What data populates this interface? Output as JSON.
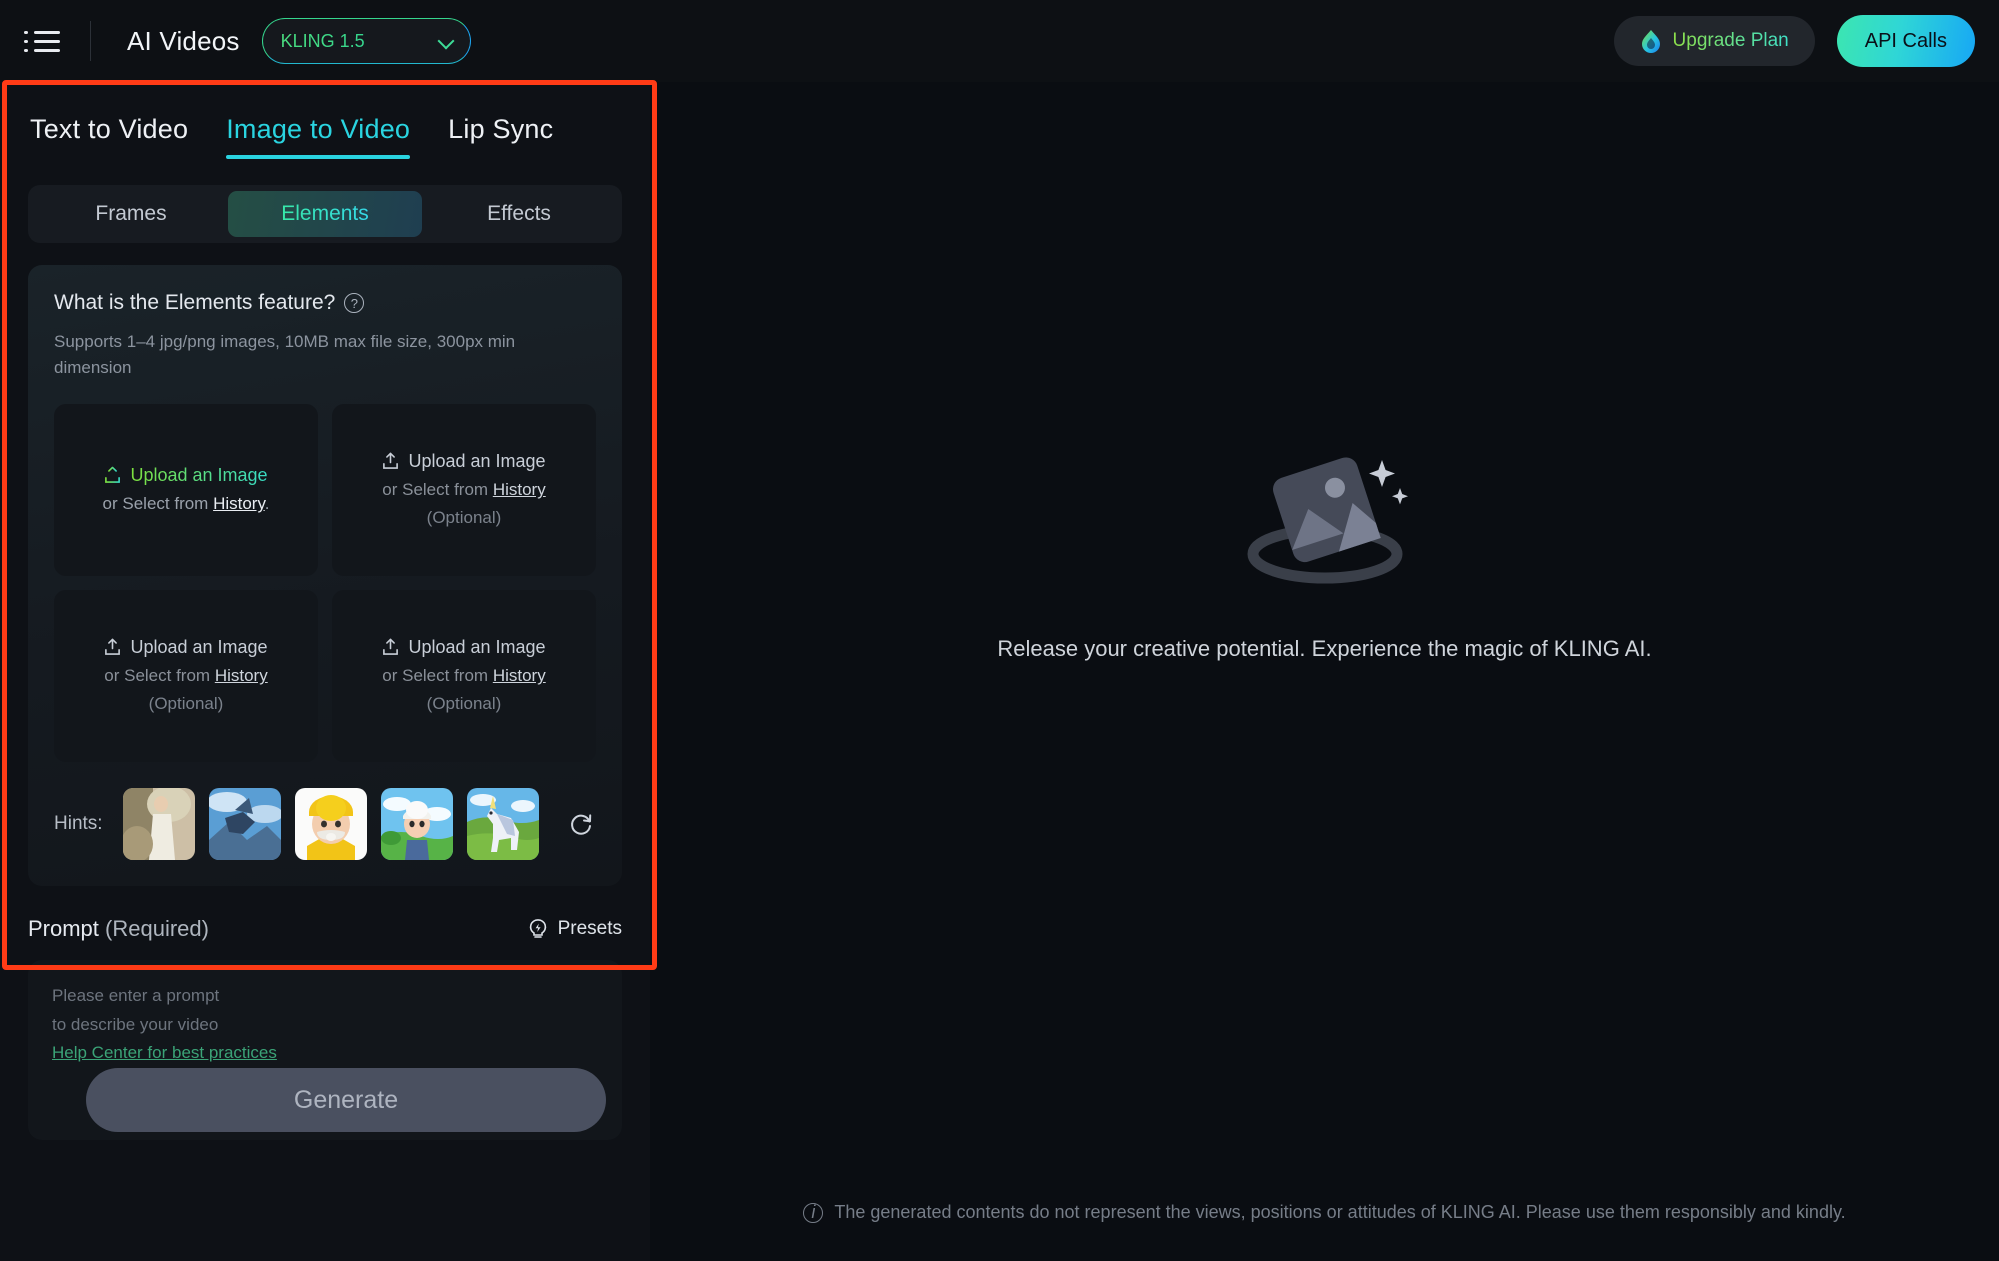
{
  "topbar": {
    "menu_icon": "hamburger-menu-icon",
    "app_title": "AI Videos",
    "model_select": {
      "value": "KLING 1.5",
      "chevron": "chevron-down-icon"
    },
    "upgrade": {
      "label": "Upgrade Plan",
      "icon": "flame-droplet-icon"
    },
    "api_calls": {
      "label": "API Calls"
    }
  },
  "left_panel": {
    "main_tabs": [
      {
        "label": "Text to Video",
        "active": false
      },
      {
        "label": "Image to Video",
        "active": true
      },
      {
        "label": "Lip Sync",
        "active": false
      }
    ],
    "mode_tabs": [
      {
        "label": "Frames",
        "active": false
      },
      {
        "label": "Elements",
        "active": true
      },
      {
        "label": "Effects",
        "active": false
      }
    ],
    "elements_card": {
      "title": "What is the Elements feature?",
      "help_icon": "question-mark-circle-icon",
      "description": "Supports 1–4 jpg/png images, 10MB max file size, 300px min dimension",
      "upload_slots": [
        {
          "icon": "upload-icon",
          "action": "Upload an Image",
          "secondary_prefix": "or Select from ",
          "secondary_link": "History",
          "secondary_suffix": ".",
          "optional": "",
          "primary": true
        },
        {
          "icon": "upload-icon",
          "action": "Upload an Image",
          "secondary_prefix": "or Select from ",
          "secondary_link": "History",
          "secondary_suffix": "",
          "optional": "(Optional)",
          "primary": false
        },
        {
          "icon": "upload-icon",
          "action": "Upload an Image",
          "secondary_prefix": "or Select from ",
          "secondary_link": "History",
          "secondary_suffix": "",
          "optional": "(Optional)",
          "primary": false
        },
        {
          "icon": "upload-icon",
          "action": "Upload an Image",
          "secondary_prefix": "or Select from ",
          "secondary_link": "History",
          "secondary_suffix": "",
          "optional": "(Optional)",
          "primary": false
        }
      ],
      "hints_label": "Hints:",
      "hints": [
        {
          "name": "hint-thumbnail-woman-in-white-dress"
        },
        {
          "name": "hint-thumbnail-flying-pegasus"
        },
        {
          "name": "hint-thumbnail-old-man-yellow-hat"
        },
        {
          "name": "hint-thumbnail-cartoon-boy-meadow"
        },
        {
          "name": "hint-thumbnail-unicorn-field"
        }
      ],
      "refresh_icon": "refresh-icon"
    },
    "prompt": {
      "label": "Prompt",
      "required_tag": "(Required)",
      "presets_label": "Presets",
      "presets_icon": "lightbulb-bolt-icon",
      "placeholder_line1": "Please enter a prompt",
      "placeholder_line2": "to describe your video",
      "placeholder_line3": "Help Center for best practices"
    },
    "generate_button": {
      "label": "Generate",
      "enabled": false
    }
  },
  "stage": {
    "empty_icon": "image-placeholder-icon",
    "empty_text": "Release your creative potential. Experience the magic of KLING AI.",
    "footer_icon": "info-circle-icon",
    "footer_text": "The generated contents do not represent the views, positions or attitudes of KLING AI. Please use them responsibly and kindly."
  },
  "annotation": {
    "highlight_color": "#ff3b16"
  },
  "colors": {
    "background": "#0a0d12",
    "panel": "#0e1116",
    "accent_cyan": "#2ad4e0",
    "accent_green": "#35d68e",
    "accent_blue": "#17a7f5"
  }
}
